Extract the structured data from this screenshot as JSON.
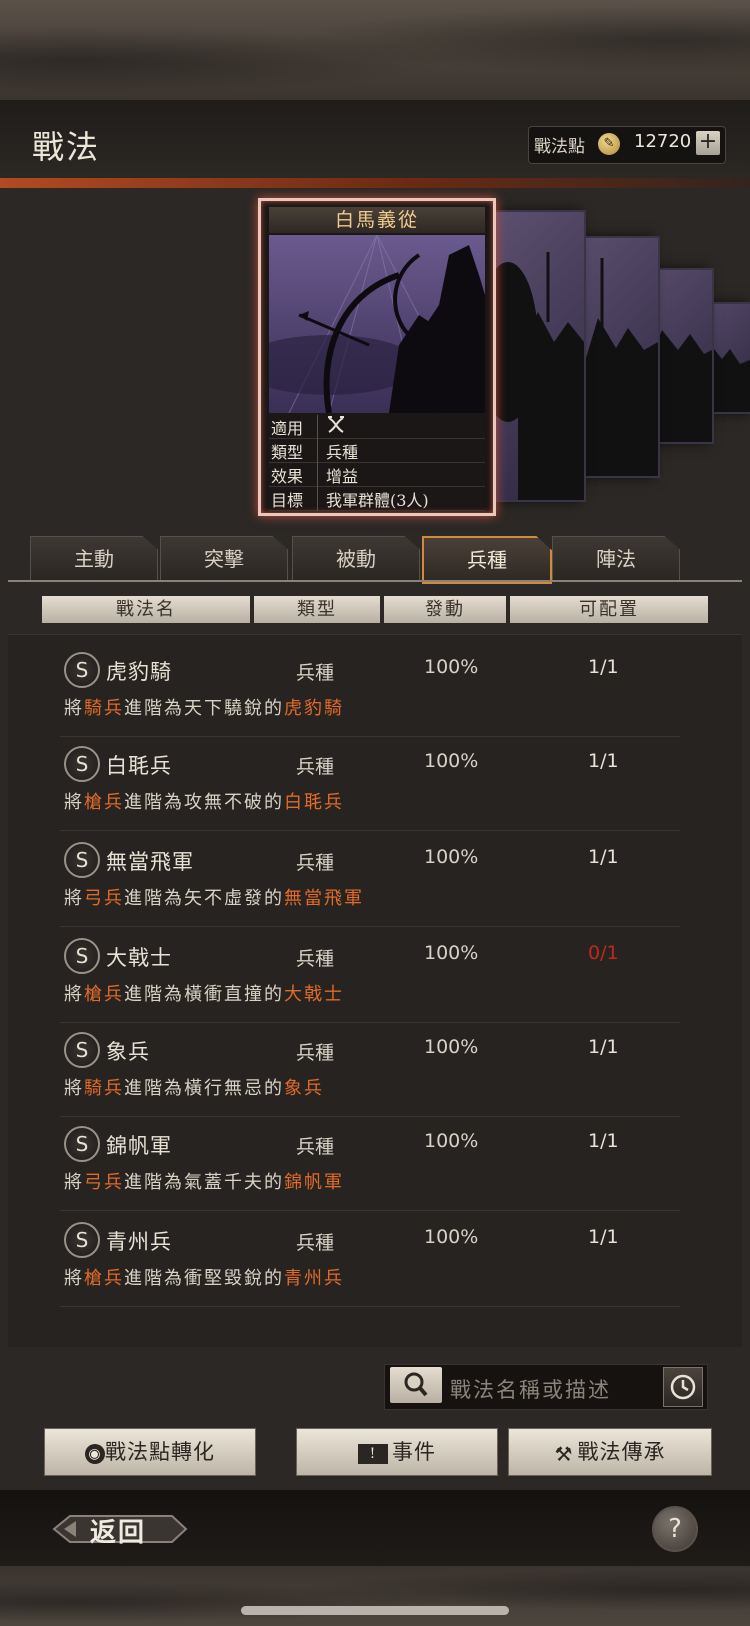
{
  "header": {
    "title": "戰法",
    "points_label": "戰法點",
    "points_value": "12720",
    "add_symbol": "+"
  },
  "card": {
    "name": "白馬義從",
    "info": [
      {
        "key": "適用",
        "value": ""
      },
      {
        "key": "類型",
        "value": "兵種"
      },
      {
        "key": "效果",
        "value": "增益"
      },
      {
        "key": "目標",
        "value": "我軍群體(3人)"
      }
    ],
    "applicable_icon": "crossed-bows-icon"
  },
  "tabs": [
    {
      "label": "主動",
      "active": false
    },
    {
      "label": "突擊",
      "active": false
    },
    {
      "label": "被動",
      "active": false
    },
    {
      "label": "兵種",
      "active": true
    },
    {
      "label": "陣法",
      "active": false
    }
  ],
  "columns": [
    "戰法名",
    "類型",
    "發動",
    "可配置"
  ],
  "rows": [
    {
      "grade": "S",
      "name": "虎豹騎",
      "type": "兵種",
      "rate": "100%",
      "qty": "1/1",
      "qty_red": false,
      "desc": {
        "pre": "將",
        "troop": "騎兵",
        "mid": "進階為天下驍銳的",
        "target": "虎豹騎"
      }
    },
    {
      "grade": "S",
      "name": "白毦兵",
      "type": "兵種",
      "rate": "100%",
      "qty": "1/1",
      "qty_red": false,
      "desc": {
        "pre": "將",
        "troop": "槍兵",
        "mid": "進階為攻無不破的",
        "target": "白毦兵"
      }
    },
    {
      "grade": "S",
      "name": "無當飛軍",
      "type": "兵種",
      "rate": "100%",
      "qty": "1/1",
      "qty_red": false,
      "desc": {
        "pre": "將",
        "troop": "弓兵",
        "mid": "進階為矢不虛發的",
        "target": "無當飛軍"
      }
    },
    {
      "grade": "S",
      "name": "大戟士",
      "type": "兵種",
      "rate": "100%",
      "qty": "0/1",
      "qty_red": true,
      "desc": {
        "pre": "將",
        "troop": "槍兵",
        "mid": "進階為橫衝直撞的",
        "target": "大戟士"
      }
    },
    {
      "grade": "S",
      "name": "象兵",
      "type": "兵種",
      "rate": "100%",
      "qty": "1/1",
      "qty_red": false,
      "desc": {
        "pre": "將",
        "troop": "騎兵",
        "mid": "進階為橫行無忌的",
        "target": "象兵"
      }
    },
    {
      "grade": "S",
      "name": "錦帆軍",
      "type": "兵種",
      "rate": "100%",
      "qty": "1/1",
      "qty_red": false,
      "desc": {
        "pre": "將",
        "troop": "弓兵",
        "mid": "進階為氣蓋千夫的",
        "target": "錦帆軍"
      }
    },
    {
      "grade": "S",
      "name": "青州兵",
      "type": "兵種",
      "rate": "100%",
      "qty": "1/1",
      "qty_red": false,
      "desc": {
        "pre": "將",
        "troop": "槍兵",
        "mid": "進階為衝堅毀銳的",
        "target": "青州兵"
      }
    }
  ],
  "search": {
    "placeholder": "戰法名稱或描述"
  },
  "actions": [
    {
      "label": "戰法點轉化",
      "icon": "flame-icon"
    },
    {
      "label": "事件",
      "icon": "scroll-icon"
    },
    {
      "label": "戰法傳承",
      "icon": "hammer-icon"
    }
  ],
  "footer": {
    "back_label": "返回",
    "help_symbol": "?"
  },
  "colors": {
    "highlight": "#e06b2a",
    "unavailable": "#c0281e",
    "active_tab": "#d08a40"
  }
}
